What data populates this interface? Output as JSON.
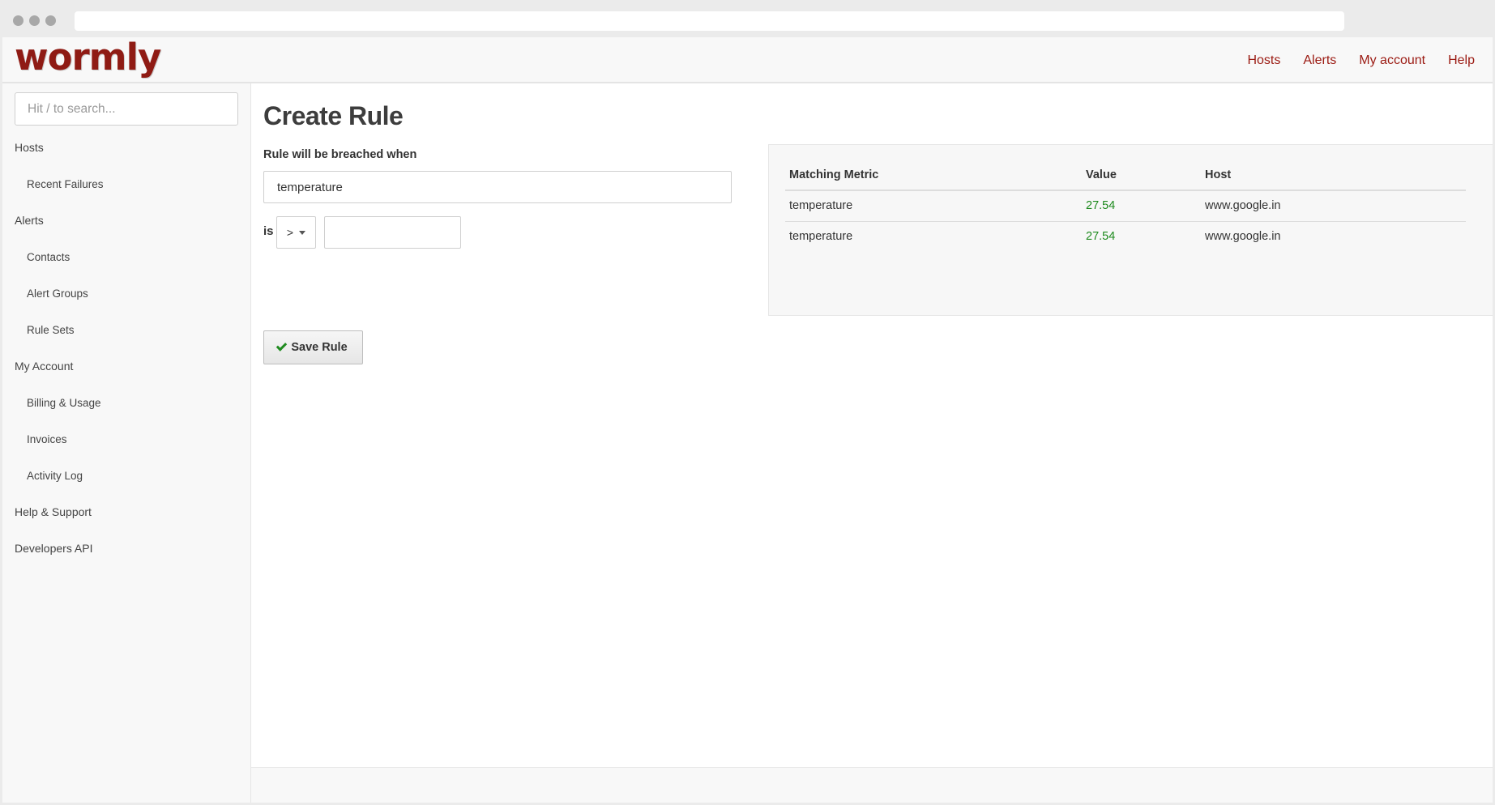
{
  "app": {
    "logo_text": "wormly"
  },
  "top_nav": [
    "Hosts",
    "Alerts",
    "My account",
    "Help"
  ],
  "sidebar": {
    "search_placeholder": "Hit / to search...",
    "items": [
      {
        "label": "Hosts",
        "sub": false
      },
      {
        "label": "Recent Failures",
        "sub": true
      },
      {
        "label": "Alerts",
        "sub": false
      },
      {
        "label": "Contacts",
        "sub": true
      },
      {
        "label": "Alert Groups",
        "sub": true
      },
      {
        "label": "Rule Sets",
        "sub": true
      },
      {
        "label": "My Account",
        "sub": false
      },
      {
        "label": "Billing & Usage",
        "sub": true
      },
      {
        "label": "Invoices",
        "sub": true
      },
      {
        "label": "Activity Log",
        "sub": true
      },
      {
        "label": "Help & Support",
        "sub": false
      },
      {
        "label": "Developers API",
        "sub": false
      }
    ]
  },
  "form": {
    "title": "Create Rule",
    "breach_label": "Rule will be breached when",
    "metric_value": "temperature",
    "is_label": "is",
    "operator": ">",
    "threshold_value": "",
    "save_label": "Save Rule"
  },
  "metrics_table": {
    "headers": [
      "Matching Metric",
      "Value",
      "Host"
    ],
    "rows": [
      [
        "temperature",
        "27.54",
        "www.google.in"
      ],
      [
        "temperature",
        "27.54",
        "www.google.in"
      ]
    ]
  },
  "colors": {
    "brand": "#8f1b14",
    "link": "#9b1a12",
    "value_green": "#1d8a1d"
  }
}
